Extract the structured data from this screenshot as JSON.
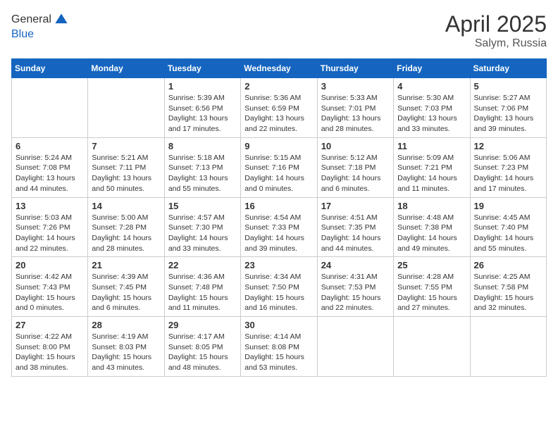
{
  "header": {
    "logo_line1": "General",
    "logo_line2": "Blue",
    "month_title": "April 2025",
    "location": "Salym, Russia"
  },
  "weekdays": [
    "Sunday",
    "Monday",
    "Tuesday",
    "Wednesday",
    "Thursday",
    "Friday",
    "Saturday"
  ],
  "weeks": [
    [
      {
        "day": "",
        "info": ""
      },
      {
        "day": "",
        "info": ""
      },
      {
        "day": "1",
        "info": "Sunrise: 5:39 AM\nSunset: 6:56 PM\nDaylight: 13 hours\nand 17 minutes."
      },
      {
        "day": "2",
        "info": "Sunrise: 5:36 AM\nSunset: 6:59 PM\nDaylight: 13 hours\nand 22 minutes."
      },
      {
        "day": "3",
        "info": "Sunrise: 5:33 AM\nSunset: 7:01 PM\nDaylight: 13 hours\nand 28 minutes."
      },
      {
        "day": "4",
        "info": "Sunrise: 5:30 AM\nSunset: 7:03 PM\nDaylight: 13 hours\nand 33 minutes."
      },
      {
        "day": "5",
        "info": "Sunrise: 5:27 AM\nSunset: 7:06 PM\nDaylight: 13 hours\nand 39 minutes."
      }
    ],
    [
      {
        "day": "6",
        "info": "Sunrise: 5:24 AM\nSunset: 7:08 PM\nDaylight: 13 hours\nand 44 minutes."
      },
      {
        "day": "7",
        "info": "Sunrise: 5:21 AM\nSunset: 7:11 PM\nDaylight: 13 hours\nand 50 minutes."
      },
      {
        "day": "8",
        "info": "Sunrise: 5:18 AM\nSunset: 7:13 PM\nDaylight: 13 hours\nand 55 minutes."
      },
      {
        "day": "9",
        "info": "Sunrise: 5:15 AM\nSunset: 7:16 PM\nDaylight: 14 hours\nand 0 minutes."
      },
      {
        "day": "10",
        "info": "Sunrise: 5:12 AM\nSunset: 7:18 PM\nDaylight: 14 hours\nand 6 minutes."
      },
      {
        "day": "11",
        "info": "Sunrise: 5:09 AM\nSunset: 7:21 PM\nDaylight: 14 hours\nand 11 minutes."
      },
      {
        "day": "12",
        "info": "Sunrise: 5:06 AM\nSunset: 7:23 PM\nDaylight: 14 hours\nand 17 minutes."
      }
    ],
    [
      {
        "day": "13",
        "info": "Sunrise: 5:03 AM\nSunset: 7:26 PM\nDaylight: 14 hours\nand 22 minutes."
      },
      {
        "day": "14",
        "info": "Sunrise: 5:00 AM\nSunset: 7:28 PM\nDaylight: 14 hours\nand 28 minutes."
      },
      {
        "day": "15",
        "info": "Sunrise: 4:57 AM\nSunset: 7:30 PM\nDaylight: 14 hours\nand 33 minutes."
      },
      {
        "day": "16",
        "info": "Sunrise: 4:54 AM\nSunset: 7:33 PM\nDaylight: 14 hours\nand 39 minutes."
      },
      {
        "day": "17",
        "info": "Sunrise: 4:51 AM\nSunset: 7:35 PM\nDaylight: 14 hours\nand 44 minutes."
      },
      {
        "day": "18",
        "info": "Sunrise: 4:48 AM\nSunset: 7:38 PM\nDaylight: 14 hours\nand 49 minutes."
      },
      {
        "day": "19",
        "info": "Sunrise: 4:45 AM\nSunset: 7:40 PM\nDaylight: 14 hours\nand 55 minutes."
      }
    ],
    [
      {
        "day": "20",
        "info": "Sunrise: 4:42 AM\nSunset: 7:43 PM\nDaylight: 15 hours\nand 0 minutes."
      },
      {
        "day": "21",
        "info": "Sunrise: 4:39 AM\nSunset: 7:45 PM\nDaylight: 15 hours\nand 6 minutes."
      },
      {
        "day": "22",
        "info": "Sunrise: 4:36 AM\nSunset: 7:48 PM\nDaylight: 15 hours\nand 11 minutes."
      },
      {
        "day": "23",
        "info": "Sunrise: 4:34 AM\nSunset: 7:50 PM\nDaylight: 15 hours\nand 16 minutes."
      },
      {
        "day": "24",
        "info": "Sunrise: 4:31 AM\nSunset: 7:53 PM\nDaylight: 15 hours\nand 22 minutes."
      },
      {
        "day": "25",
        "info": "Sunrise: 4:28 AM\nSunset: 7:55 PM\nDaylight: 15 hours\nand 27 minutes."
      },
      {
        "day": "26",
        "info": "Sunrise: 4:25 AM\nSunset: 7:58 PM\nDaylight: 15 hours\nand 32 minutes."
      }
    ],
    [
      {
        "day": "27",
        "info": "Sunrise: 4:22 AM\nSunset: 8:00 PM\nDaylight: 15 hours\nand 38 minutes."
      },
      {
        "day": "28",
        "info": "Sunrise: 4:19 AM\nSunset: 8:03 PM\nDaylight: 15 hours\nand 43 minutes."
      },
      {
        "day": "29",
        "info": "Sunrise: 4:17 AM\nSunset: 8:05 PM\nDaylight: 15 hours\nand 48 minutes."
      },
      {
        "day": "30",
        "info": "Sunrise: 4:14 AM\nSunset: 8:08 PM\nDaylight: 15 hours\nand 53 minutes."
      },
      {
        "day": "",
        "info": ""
      },
      {
        "day": "",
        "info": ""
      },
      {
        "day": "",
        "info": ""
      }
    ]
  ]
}
